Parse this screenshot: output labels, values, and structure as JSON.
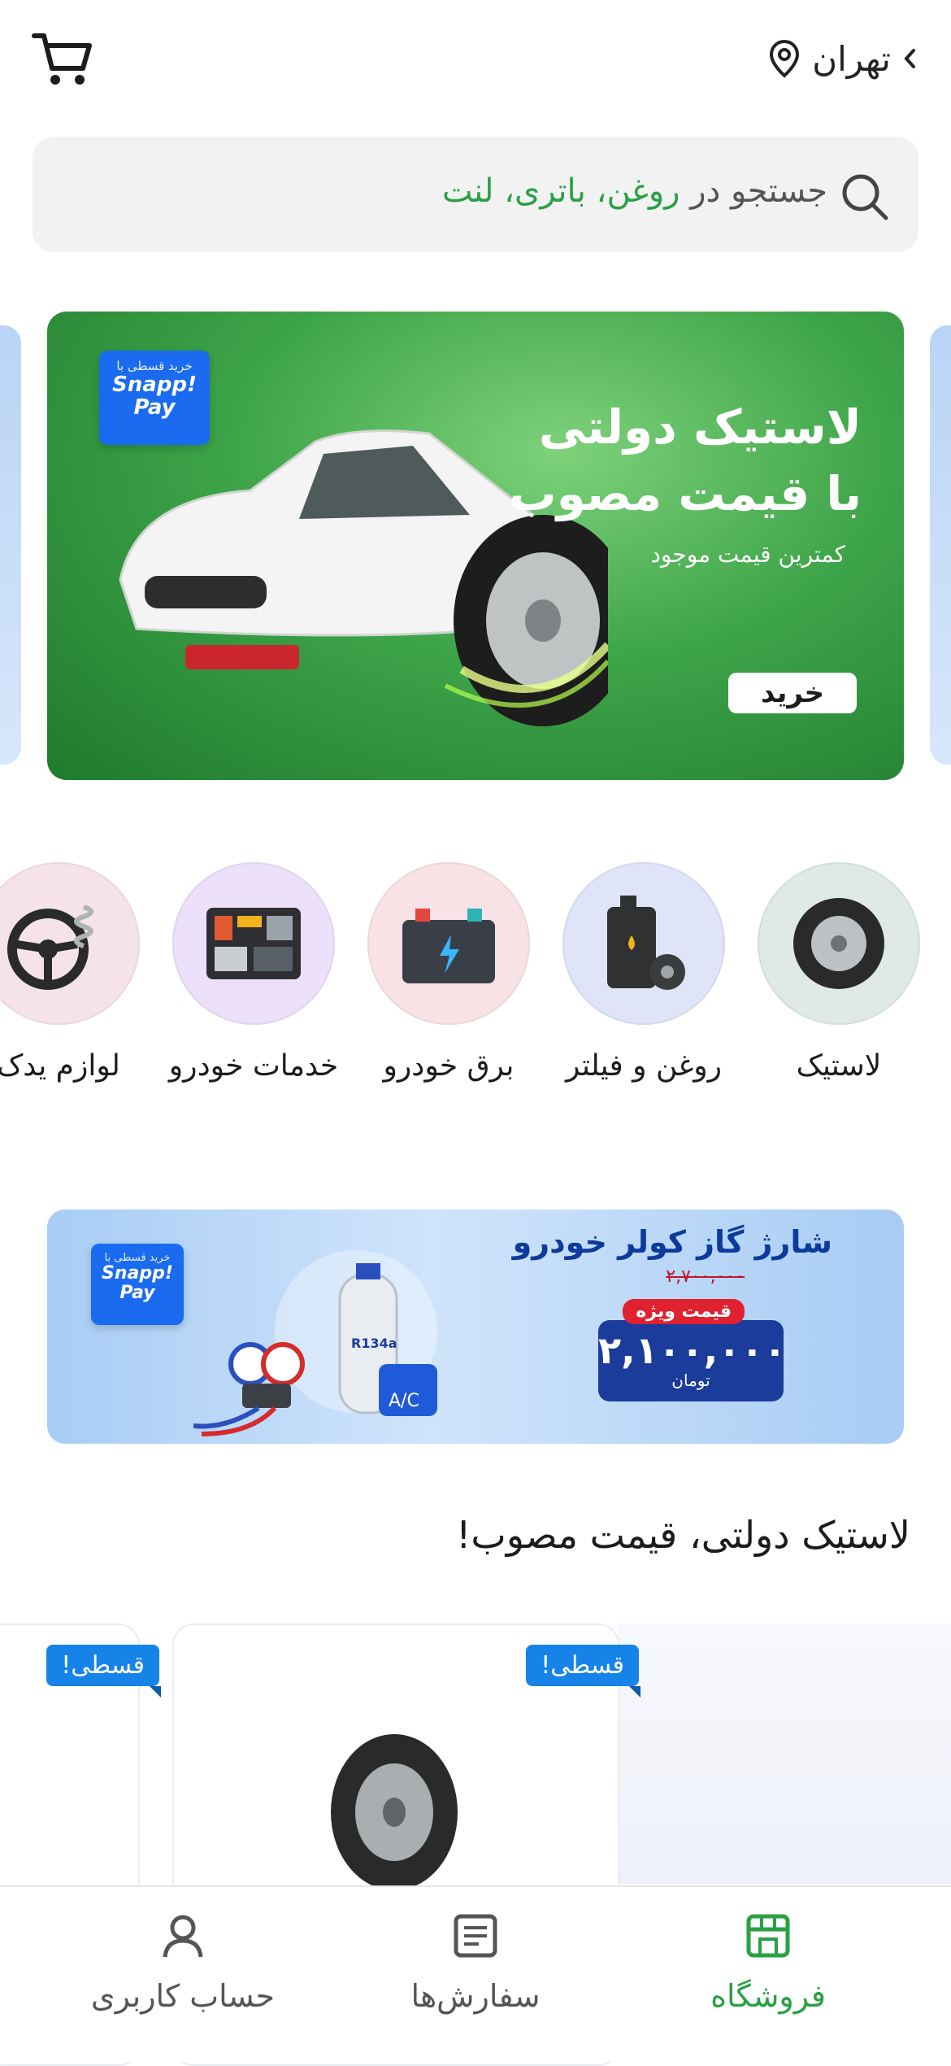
{
  "header": {
    "city": "تهران"
  },
  "search": {
    "prefix": "جستجو در",
    "keywords": "روغن، باتری، لنت"
  },
  "hero_banner": {
    "title_line1": "لاستیک دولتی",
    "title_line2": "با قیمت مصوب",
    "subtitle": "کمترین قیمت موجود",
    "button": "خرید",
    "snapp_small": "خرید قسطی با",
    "snapp_big": "Snapp! Pay"
  },
  "categories": [
    {
      "label": "لاستیک",
      "bg": "#dfe9e8"
    },
    {
      "label": "روغن و فیلتر",
      "bg": "#dfe4f8"
    },
    {
      "label": "برق خودرو",
      "bg": "#f9e2e6"
    },
    {
      "label": "خدمات خودرو",
      "bg": "#ece0fa"
    },
    {
      "label": "لوازم یدک",
      "bg": "#f6e3e8"
    }
  ],
  "ac_banner": {
    "title": "شارژ گاز کولر خودرو",
    "old_price": "۲,۷۰۰,۰۰۰",
    "badge": "قیمت ویژه",
    "price": "۲,۱۰۰,۰۰۰",
    "currency": "تومان",
    "snapp_small": "خرید قسطی با",
    "snapp_big": "Snapp! Pay",
    "tank_label": "R134a",
    "ac_label": "A/C"
  },
  "section": {
    "title": "لاستیک دولتی، قیمت مصوب!"
  },
  "products": [
    {
      "badge": "قسطی!"
    },
    {
      "badge": "قسطی!"
    }
  ],
  "bottom_nav": {
    "items": [
      {
        "label": "فروشگاه",
        "active": true
      },
      {
        "label": "سفارش‌ها",
        "active": false
      },
      {
        "label": "حساب کاربری",
        "active": false
      }
    ],
    "active_color": "#2aa045",
    "inactive_color": "#555555"
  }
}
